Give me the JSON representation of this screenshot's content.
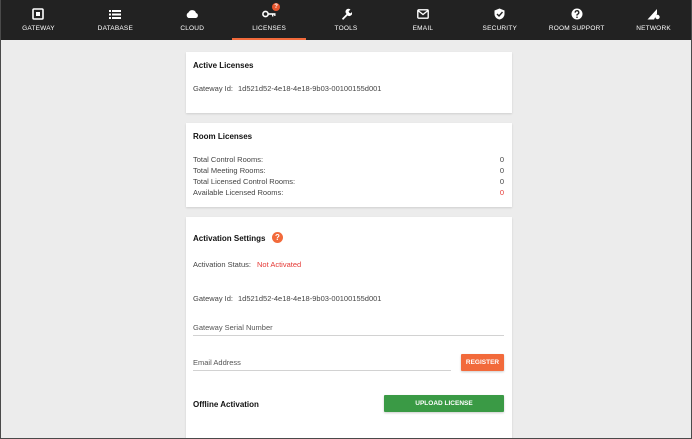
{
  "nav": {
    "items": [
      {
        "label": "GATEWAY",
        "icon": "gateway-icon"
      },
      {
        "label": "DATABASE",
        "icon": "list-icon"
      },
      {
        "label": "CLOUD",
        "icon": "cloud-icon"
      },
      {
        "label": "LICENSES",
        "icon": "key-icon",
        "badge": "?"
      },
      {
        "label": "TOOLS",
        "icon": "wrench-icon"
      },
      {
        "label": "EMAIL",
        "icon": "envelope-icon"
      },
      {
        "label": "SECURITY",
        "icon": "shield-icon"
      },
      {
        "label": "ROOM SUPPORT",
        "icon": "help-icon"
      },
      {
        "label": "NETWORK",
        "icon": "signal-icon"
      }
    ],
    "active": "LICENSES"
  },
  "active_licenses": {
    "title": "Active Licenses",
    "gateway_label": "Gateway Id:",
    "gateway_id": "1d521d52-4e18-4e18-9b03-00100155d001"
  },
  "room_licenses": {
    "title": "Room Licenses",
    "rows": [
      {
        "label": "Total Control Rooms:",
        "value": "0"
      },
      {
        "label": "Total Meeting Rooms:",
        "value": "0"
      },
      {
        "label": "Total Licensed Control Rooms:",
        "value": "0"
      },
      {
        "label": "Available Licensed Rooms:",
        "value": "0"
      }
    ]
  },
  "activation": {
    "title": "Activation Settings",
    "help": "?",
    "status_label": "Activation Status:",
    "status_value": "Not Activated",
    "gateway_label": "Gateway Id:",
    "gateway_id": "1d521d52-4e18-4e18-9b03-00100155d001",
    "serial_placeholder": "Gateway Serial Number",
    "email_placeholder": "Email Address",
    "register_label": "REGISTER",
    "offline_label": "Offline Activation",
    "upload_label": "UPLOAD LICENSE"
  },
  "colors": {
    "nav_bg": "#222222",
    "accent": "#f26a3b",
    "upload": "#3a9a45",
    "error": "#e53935"
  }
}
